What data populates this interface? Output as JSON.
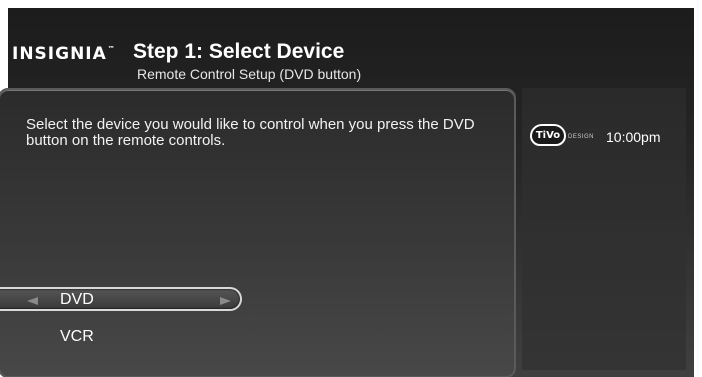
{
  "header": {
    "brand": "INSIGNIA",
    "brand_mark": "™",
    "title": "Step 1: Select Device",
    "subtitle": "Remote Control Setup (DVD button)"
  },
  "main": {
    "description": "Select the device you would like to control when you press the DVD button on the remote controls.",
    "options": [
      {
        "label": "DVD",
        "selected": true
      },
      {
        "label": "VCR",
        "selected": false
      }
    ]
  },
  "status": {
    "tivo_logo_text": "TiVo",
    "tivo_design_text": "DESIGN",
    "time": "10:00pm"
  },
  "icons": {
    "left": "arrow-left-icon",
    "right": "arrow-right-icon"
  },
  "colors": {
    "background_top": "#1c1c1c",
    "background_bottom": "#404040",
    "selection_border": "#d8d8d8",
    "text": "#ffffff"
  }
}
